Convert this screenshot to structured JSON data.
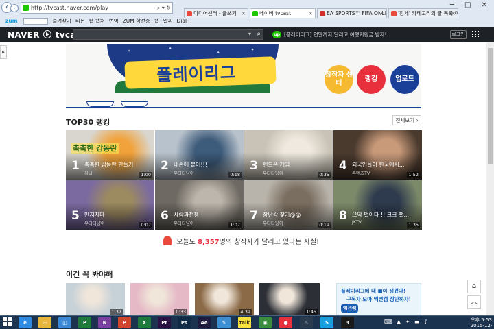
{
  "browser": {
    "url": "http://tvcast.naver.com/play",
    "window_controls": "─ □ ✕",
    "tabs": [
      {
        "title": "미디어센터 - 글쓰기",
        "icon_color": "#e84b3c",
        "active": false
      },
      {
        "title": "네이버 tvcast",
        "icon_color": "#1ec800",
        "active": true
      },
      {
        "title": "EA SPORTS™ FIFA ONLINE 3",
        "icon_color": "#d32f2f",
        "active": false
      },
      {
        "title": "'전체' 카테고리의 글 목록 미디...",
        "icon_color": "#e84b3c",
        "active": false
      }
    ],
    "favorites_bar": {
      "zum": "zum",
      "items": [
        "즐겨찾기",
        "티몬",
        "웹 캡처",
        "번역",
        "ZUM 학전송",
        "캡",
        "알씨",
        "Dial+"
      ]
    }
  },
  "header": {
    "logo_text": "NAVER",
    "logo_suffix": "tvcast",
    "search_dropdown": "▾",
    "search_icon": "search-icon",
    "up_badge": "up",
    "promo_text": "[플레이리그] 연말까지 달리고 여행지원금 받자!",
    "login_label": "로그인",
    "accent_color": "#1ec800"
  },
  "banner": {
    "title": "플레이리그",
    "circle_buttons": [
      {
        "label": "창작자 센터",
        "color": "#f5b932"
      },
      {
        "label": "랭킹",
        "color": "#e8303c"
      },
      {
        "label": "업로드",
        "color": "#1a3f99"
      }
    ]
  },
  "top30": {
    "title": "TOP30 랭킹",
    "see_all_label": "전체보기 ›",
    "cards": [
      {
        "rank": "1",
        "title": "촉촉한 감동란 만들기",
        "channel": "하나",
        "duration": "1:00",
        "bg": "#d9d6cf",
        "accent": "#f2a23a",
        "overlay": "촉촉한 감동란"
      },
      {
        "rank": "2",
        "title": "내손에 붙어!!!",
        "channel": "우다다냥이",
        "duration": "0:18",
        "bg": "#b8c2cc",
        "accent": "#3d5b7a",
        "overlay": ""
      },
      {
        "rank": "3",
        "title": "핸드폰 게임",
        "channel": "우다다냥이",
        "duration": "0:35",
        "bg": "#c9c3b7",
        "accent": "#efe9df",
        "overlay": ""
      },
      {
        "rank": "4",
        "title": "외국인들이 한국에서...",
        "channel": "콘텐츠TV",
        "duration": "1:52",
        "bg": "#4a3a2e",
        "accent": "#c99a7a",
        "overlay": ""
      },
      {
        "rank": "5",
        "title": "만지지마",
        "channel": "우다다냥이",
        "duration": "0:07",
        "bg": "#7b6aa0",
        "accent": "#9c8a60",
        "overlay": ""
      },
      {
        "rank": "6",
        "title": "사람과전쟁",
        "channel": "우다다냥이",
        "duration": "1:07",
        "bg": "#6e6962",
        "accent": "#bdb6ac",
        "overlay": ""
      },
      {
        "rank": "7",
        "title": "장난감 찾기@@",
        "channel": "우다다냥이",
        "duration": "0:19",
        "bg": "#b9b4ab",
        "accent": "#7a6e60",
        "overlay": ""
      },
      {
        "rank": "8",
        "title": "으악 벌이다 !! 크크 뻘...",
        "channel": "JKTV",
        "duration": "1:35",
        "bg": "#7d8a6a",
        "accent": "#2e3a4d",
        "overlay": ""
      }
    ]
  },
  "creators_line": {
    "prefix": "오늘도",
    "count": "8,357",
    "suffix": "명의 창작자가 달리고 있다는 사실!"
  },
  "must_see": {
    "title": "이건 꼭 봐야해",
    "videos": [
      {
        "duration": "1:37",
        "bg": "#c7d1d8"
      },
      {
        "duration": "0:33",
        "bg": "#e5b9c6"
      },
      {
        "duration": "4:39",
        "bg": "#8b6a47"
      },
      {
        "duration": "1:45",
        "bg": "#2c2f36"
      }
    ],
    "ad": {
      "line1": "플레이리그에 내 ■이 생겼다!",
      "line2": "구독자 모아 액션캠 장만하자!",
      "line3": "액션캠"
    }
  },
  "float_buttons": {
    "top": "⌂",
    "up": "︿"
  },
  "taskbar": {
    "apps": [
      {
        "name": "ie-icon",
        "color": "#2f8ae0",
        "glyph": "e"
      },
      {
        "name": "folder-icon",
        "color": "#e8b53d",
        "glyph": "▭"
      },
      {
        "name": "store-icon",
        "color": "#3a88d6",
        "glyph": "◫"
      },
      {
        "name": "project-icon",
        "color": "#1f7a3e",
        "glyph": "P"
      },
      {
        "name": "onenote-icon",
        "color": "#7b3fa0",
        "glyph": "N"
      },
      {
        "name": "powerpoint-icon",
        "color": "#d0452c",
        "glyph": "P"
      },
      {
        "name": "excel-icon",
        "color": "#1f7a3e",
        "glyph": "X"
      },
      {
        "name": "premiere-icon",
        "color": "#2b1245",
        "glyph": "Pr"
      },
      {
        "name": "photoshop-icon",
        "color": "#0f2b45",
        "glyph": "Ps"
      },
      {
        "name": "aftereffects-icon",
        "color": "#1e1a3d",
        "glyph": "Ae"
      },
      {
        "name": "paint-icon",
        "color": "#3e8ed0",
        "glyph": "✎"
      },
      {
        "name": "kakaotalk-icon",
        "color": "#f7e13b",
        "glyph": "talk"
      },
      {
        "name": "chrome-icon",
        "color": "#3b8e3e",
        "glyph": "◉"
      },
      {
        "name": "record-icon",
        "color": "#e8303c",
        "glyph": "●"
      },
      {
        "name": "steam-icon",
        "color": "#2a3b4f",
        "glyph": "♨"
      },
      {
        "name": "skype-icon",
        "color": "#1a9ee0",
        "glyph": "S"
      },
      {
        "name": "fifa-icon",
        "color": "#1b1b1b",
        "glyph": "3"
      }
    ],
    "systray": "⌨ ▲ ✦ ▬ ♪",
    "time": "오후 5:53",
    "date": "2015-12-15"
  }
}
